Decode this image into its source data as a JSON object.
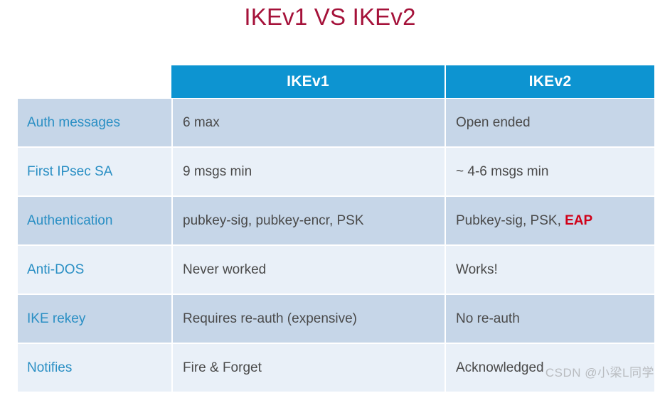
{
  "slide": {
    "title": "IKEv1 VS IKEv2",
    "title_color": "#a5123a",
    "background_color": "#ffffff"
  },
  "table": {
    "header": {
      "corner_label": "",
      "columns": [
        "IKEv1",
        "IKEv2"
      ],
      "background_color": "#0d94d1",
      "text_color": "#ffffff"
    },
    "row_colors": {
      "dark": "#c6d6e8",
      "light": "#e9f0f8",
      "label_text": "#2a8fc4",
      "value_text": "#4a4a4a",
      "highlight": "#d00018"
    },
    "rows": [
      {
        "label": "Auth messages",
        "ikev1": "6 max",
        "ikev2": "Open ended",
        "ikev2_highlight": ""
      },
      {
        "label": "First IPsec SA",
        "ikev1": "9 msgs min",
        "ikev2": "~ 4-6 msgs min",
        "ikev2_highlight": ""
      },
      {
        "label": "Authentication",
        "ikev1": "pubkey-sig, pubkey-encr, PSK",
        "ikev2": "Pubkey-sig, PSK, ",
        "ikev2_highlight": "EAP"
      },
      {
        "label": "Anti-DOS",
        "ikev1": "Never worked",
        "ikev2": "Works!",
        "ikev2_highlight": ""
      },
      {
        "label": "IKE rekey",
        "ikev1": "Requires re-auth (expensive)",
        "ikev2": "No re-auth",
        "ikev2_highlight": ""
      },
      {
        "label": "Notifies",
        "ikev1": "Fire & Forget",
        "ikev2": "Acknowledged",
        "ikev2_highlight": ""
      }
    ]
  },
  "watermark": {
    "text": "CSDN @小梁L同学"
  }
}
